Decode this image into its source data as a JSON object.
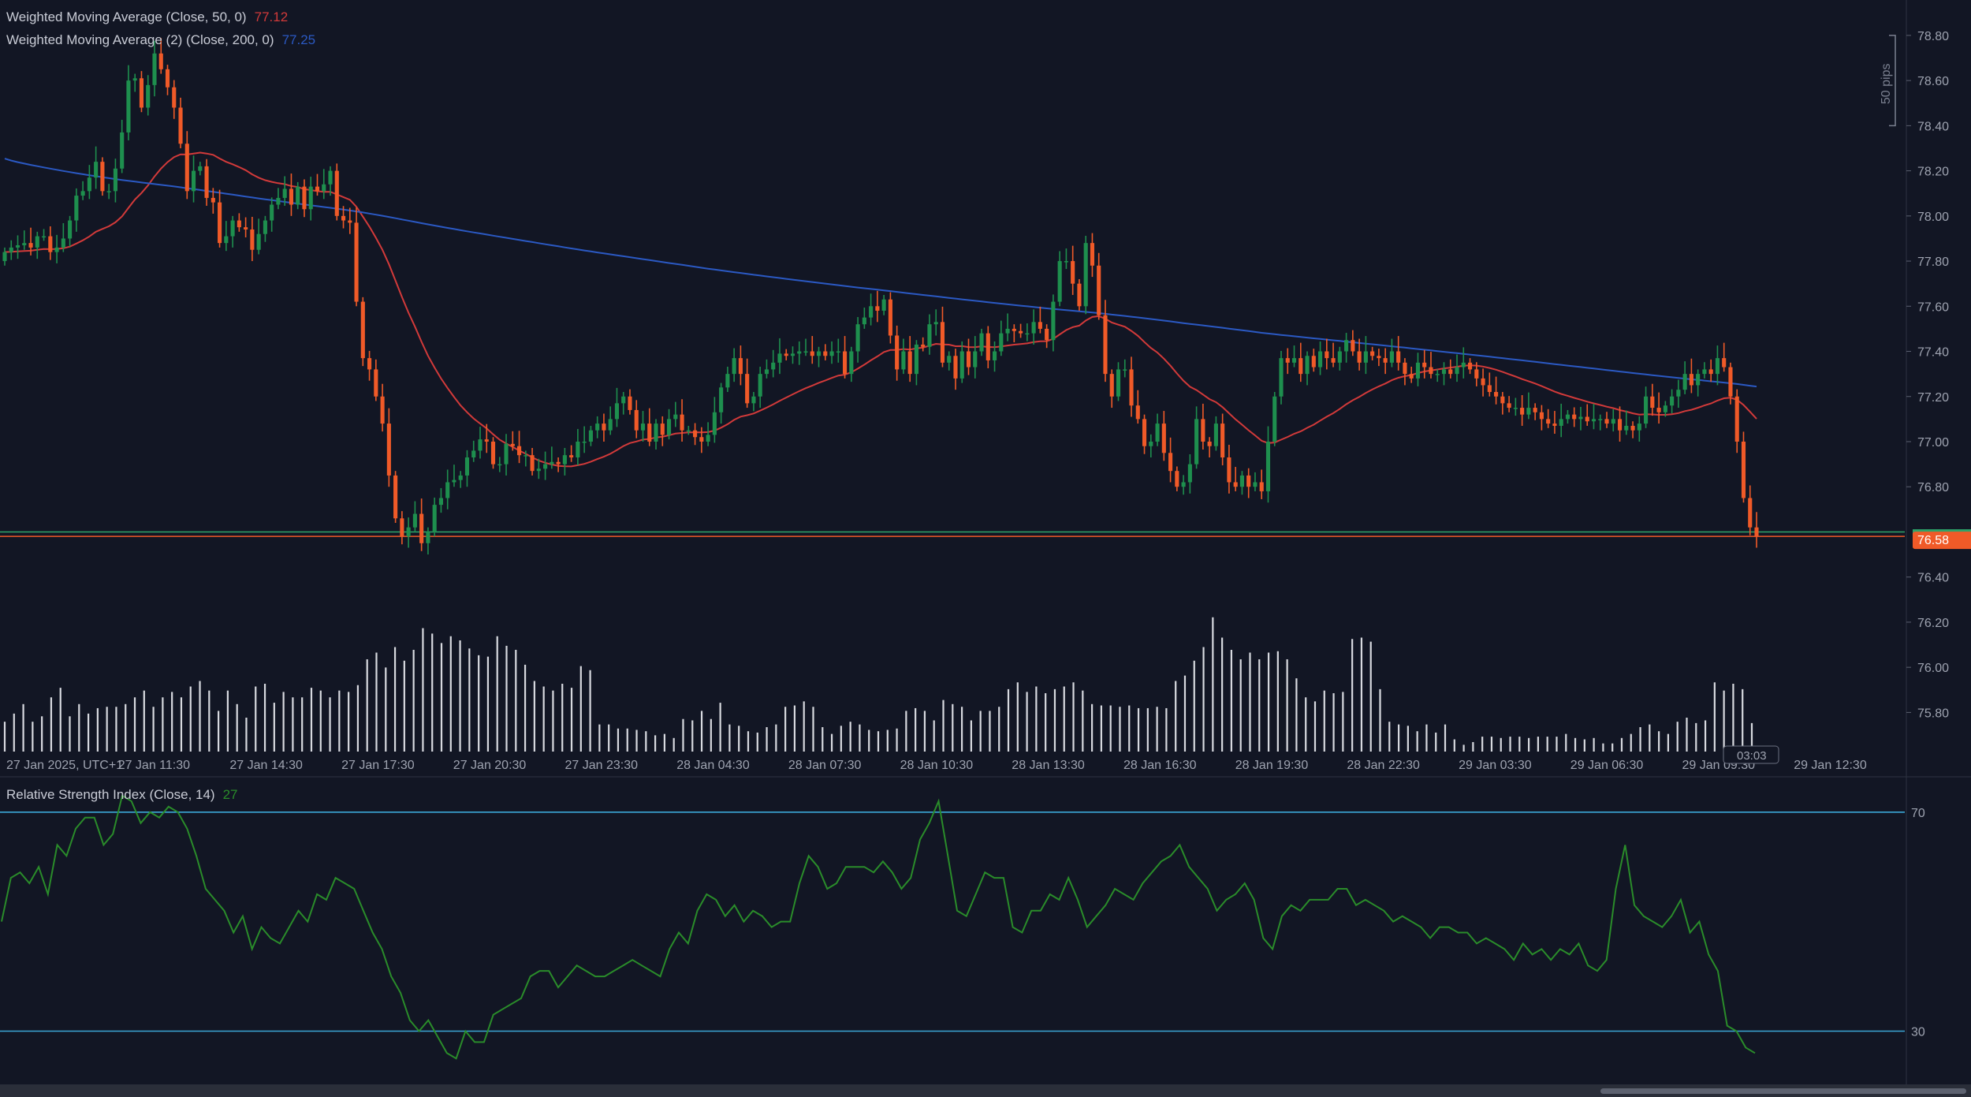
{
  "colors": {
    "background": "#121624",
    "up": "#1e8f4e",
    "down": "#f05a28",
    "wma50": "#d23a3a",
    "wma200": "#2b59c3",
    "rsi": "#2a8c2a",
    "rsi_band": "#3ba7d6",
    "bid_line": "#2ea36a",
    "ask_line": "#f05a28",
    "grid_text": "#9ea3b0",
    "volume": "#d8dae0"
  },
  "legend": {
    "wma50_label": "Weighted Moving Average (Close, 50, 0)",
    "wma50_value": "77.12",
    "wma200_label": "Weighted Moving Average (2) (Close, 200, 0)",
    "wma200_value": "77.25",
    "rsi_label": "Relative Strength Index (Close, 14)",
    "rsi_value": "27"
  },
  "price_axis": {
    "ticks": [
      "78.80",
      "78.60",
      "78.40",
      "78.20",
      "78.00",
      "77.80",
      "77.60",
      "77.40",
      "77.20",
      "77.00",
      "76.80",
      "76.40",
      "76.20",
      "76.00",
      "75.80"
    ],
    "current_price": "76.58",
    "range_label": "50 pips"
  },
  "rsi_axis": {
    "ticks": [
      "70",
      "30"
    ]
  },
  "time_axis": {
    "labels": [
      "27 Jan 2025, UTC+1",
      "27 Jan 11:30",
      "27 Jan 14:30",
      "27 Jan 17:30",
      "27 Jan 20:30",
      "27 Jan 23:30",
      "28 Jan 04:30",
      "28 Jan 07:30",
      "28 Jan 10:30",
      "28 Jan 13:30",
      "28 Jan 16:30",
      "28 Jan 19:30",
      "28 Jan 22:30",
      "29 Jan 03:30",
      "29 Jan 06:30",
      "29 Jan 09:30",
      "29 Jan 12:30"
    ],
    "countdown": "03:03"
  },
  "chart_data": {
    "type": "candlestick",
    "price_scale": [
      75.7,
      78.88
    ],
    "horizontal_lines": [
      {
        "name": "bid",
        "value": 76.6
      },
      {
        "name": "ask",
        "value": 76.58
      }
    ],
    "closes": [
      77.84,
      77.86,
      77.87,
      77.88,
      77.86,
      77.91,
      77.91,
      77.84,
      77.86,
      77.9,
      77.98,
      78.09,
      78.11,
      78.17,
      78.24,
      78.11,
      78.11,
      78.21,
      78.37,
      78.6,
      78.61,
      78.48,
      78.58,
      78.72,
      78.65,
      78.57,
      78.48,
      78.32,
      78.11,
      78.2,
      78.22,
      78.08,
      78.06,
      77.88,
      77.91,
      77.98,
      77.95,
      77.94,
      77.85,
      77.92,
      77.98,
      78.05,
      78.08,
      78.12,
      78.05,
      78.13,
      78.03,
      78.13,
      78.11,
      78.14,
      78.2,
      78.0,
      77.98,
      77.97,
      77.62,
      77.37,
      77.32,
      77.2,
      77.08,
      76.85,
      76.66,
      76.58,
      76.62,
      76.68,
      76.55,
      76.6,
      76.72,
      76.75,
      76.82,
      76.83,
      76.85,
      76.93,
      76.96,
      77.01,
      77.0,
      76.9,
      76.9,
      76.99,
      76.98,
      76.94,
      76.94,
      76.87,
      76.88,
      76.9,
      76.91,
      76.9,
      76.94,
      76.93,
      77.0,
      77.0,
      77.05,
      77.08,
      77.05,
      77.1,
      77.17,
      77.2,
      77.14,
      77.05,
      77.08,
      77.0,
      77.08,
      77.03,
      77.1,
      77.12,
      77.05,
      77.05,
      77.02,
      77.0,
      77.03,
      77.13,
      77.24,
      77.3,
      77.37,
      77.3,
      77.17,
      77.2,
      77.3,
      77.32,
      77.35,
      77.39,
      77.38,
      77.39,
      77.4,
      77.4,
      77.38,
      77.4,
      77.38,
      77.4,
      77.4,
      77.3,
      77.4,
      77.52,
      77.55,
      77.6,
      77.58,
      77.63,
      77.47,
      77.32,
      77.4,
      77.3,
      77.43,
      77.42,
      77.52,
      77.53,
      77.35,
      77.38,
      77.28,
      77.4,
      77.33,
      77.4,
      77.48,
      77.36,
      77.4,
      77.48,
      77.5,
      77.49,
      77.48,
      77.48,
      77.53,
      77.5,
      77.45,
      77.62,
      77.8,
      77.8,
      77.7,
      77.6,
      77.88,
      77.78,
      77.56,
      77.3,
      77.2,
      77.32,
      77.32,
      77.16,
      77.1,
      76.98,
      77.0,
      77.08,
      76.95,
      76.87,
      76.8,
      76.82,
      76.9,
      77.1,
      77.0,
      76.98,
      77.08,
      76.93,
      76.82,
      76.8,
      76.85,
      76.8,
      76.82,
      76.78,
      77.0,
      77.2,
      77.37,
      77.35,
      77.37,
      77.3,
      77.38,
      77.33,
      77.4,
      77.37,
      77.35,
      77.4,
      77.45,
      77.4,
      77.35,
      77.4,
      77.38,
      77.37,
      77.35,
      77.4,
      77.35,
      77.3,
      77.28,
      77.35,
      77.33,
      77.3,
      77.3,
      77.32,
      77.3,
      77.33,
      77.35,
      77.32,
      77.28,
      77.25,
      77.22,
      77.2,
      77.17,
      77.15,
      77.15,
      77.12,
      77.15,
      77.13,
      77.1,
      77.08,
      77.07,
      77.1,
      77.12,
      77.1,
      77.11,
      77.09,
      77.1,
      77.1,
      77.08,
      77.1,
      77.05,
      77.07,
      77.05,
      77.08,
      77.2,
      77.15,
      77.13,
      77.16,
      77.2,
      77.23,
      77.3,
      77.25,
      77.3,
      77.32,
      77.3,
      77.37,
      77.33,
      77.2,
      77.0,
      76.75,
      76.62,
      76.58
    ],
    "wma50_start": 77.82,
    "wma50_end": 77.12,
    "wma200_start": 78.29,
    "wma200_end": 77.25,
    "rsi_scale": [
      21,
      74
    ],
    "rsi_bands": [
      70,
      30
    ],
    "rsi": [
      50,
      58,
      59,
      57,
      60,
      55,
      64,
      62,
      67,
      69,
      69,
      64,
      66,
      73,
      72,
      68,
      70,
      69,
      71,
      70,
      67,
      62,
      56,
      54,
      52,
      48,
      51,
      45,
      49,
      47,
      46,
      49,
      52,
      50,
      55,
      54,
      58,
      57,
      56,
      52,
      48,
      45,
      40,
      37,
      32,
      30,
      32,
      29,
      26,
      25,
      30,
      28,
      28,
      33,
      34,
      35,
      36,
      40,
      41,
      41,
      38,
      40,
      42,
      41,
      40,
      40,
      41,
      42,
      43,
      42,
      41,
      40,
      45,
      48,
      46,
      52,
      55,
      54,
      51,
      53,
      50,
      52,
      51,
      49,
      50,
      50,
      57,
      62,
      60,
      56,
      57,
      60,
      60,
      60,
      59,
      61,
      59,
      56,
      58,
      65,
      68,
      72,
      62,
      52,
      51,
      55,
      59,
      58,
      58,
      49,
      48,
      52,
      52,
      55,
      54,
      58,
      54,
      49,
      51,
      53,
      56,
      55,
      54,
      57,
      59,
      61,
      62,
      64,
      60,
      58,
      56,
      52,
      54,
      55,
      57,
      54,
      47,
      45,
      51,
      53,
      52,
      54,
      54,
      54,
      56,
      56,
      53,
      54,
      53,
      52,
      50,
      51,
      50,
      49,
      47,
      49,
      49,
      48,
      48,
      46,
      47,
      46,
      45,
      43,
      46,
      44,
      45,
      43,
      45,
      44,
      46,
      42,
      41,
      43,
      56,
      64,
      53,
      51,
      50,
      49,
      51,
      54,
      48,
      50,
      44,
      41,
      31,
      30,
      27,
      26
    ],
    "volume_scale": [
      0,
      1
    ],
    "volume": [
      0.22,
      0.28,
      0.35,
      0.22,
      0.26,
      0.4,
      0.47,
      0.26,
      0.35,
      0.28,
      0.32,
      0.33,
      0.33,
      0.35,
      0.4,
      0.45,
      0.33,
      0.4,
      0.44,
      0.4,
      0.48,
      0.52,
      0.45,
      0.3,
      0.45,
      0.35,
      0.25,
      0.48,
      0.5,
      0.36,
      0.44,
      0.4,
      0.4,
      0.47,
      0.45,
      0.4,
      0.45,
      0.44,
      0.49,
      0.68,
      0.73,
      0.62,
      0.77,
      0.67,
      0.75,
      0.91,
      0.87,
      0.8,
      0.85,
      0.82,
      0.76,
      0.71,
      0.7,
      0.85,
      0.78,
      0.75,
      0.64,
      0.52,
      0.48,
      0.45,
      0.5,
      0.47,
      0.63,
      0.6,
      0.2,
      0.2,
      0.17,
      0.17,
      0.16,
      0.15,
      0.12,
      0.13,
      0.1,
      0.24,
      0.23,
      0.3,
      0.24,
      0.36,
      0.2,
      0.19,
      0.15,
      0.14,
      0.18,
      0.2,
      0.33,
      0.34,
      0.37,
      0.33,
      0.18,
      0.13,
      0.19,
      0.22,
      0.2,
      0.16,
      0.15,
      0.16,
      0.17,
      0.3,
      0.32,
      0.3,
      0.23,
      0.38,
      0.35,
      0.33,
      0.23,
      0.3,
      0.3,
      0.33,
      0.46,
      0.51,
      0.44,
      0.48,
      0.43,
      0.46,
      0.48,
      0.51,
      0.45,
      0.35,
      0.34,
      0.34,
      0.33,
      0.34,
      0.32,
      0.32,
      0.33,
      0.32,
      0.52,
      0.56,
      0.67,
      0.77,
      0.99,
      0.84,
      0.75,
      0.68,
      0.73,
      0.68,
      0.73,
      0.74,
      0.68,
      0.54,
      0.4,
      0.37,
      0.45,
      0.43,
      0.44,
      0.83,
      0.84,
      0.81,
      0.46,
      0.22,
      0.2,
      0.19,
      0.15,
      0.2,
      0.14,
      0.2,
      0.09,
      0.05,
      0.07,
      0.11,
      0.11,
      0.1,
      0.11,
      0.11,
      0.1,
      0.11,
      0.11,
      0.11,
      0.13,
      0.1,
      0.09,
      0.1,
      0.06,
      0.06,
      0.1,
      0.13,
      0.18,
      0.2,
      0.15,
      0.13,
      0.22,
      0.25,
      0.21,
      0.23,
      0.51,
      0.45,
      0.5,
      0.46,
      0.21
    ],
    "x_time_labels": [
      "27 Jan 2025, UTC+1",
      "27 Jan 11:30",
      "27 Jan 14:30",
      "27 Jan 17:30",
      "27 Jan 20:30",
      "27 Jan 23:30",
      "28 Jan 04:30",
      "28 Jan 07:30",
      "28 Jan 10:30",
      "28 Jan 13:30",
      "28 Jan 16:30",
      "28 Jan 19:30",
      "28 Jan 22:30",
      "29 Jan 03:30",
      "29 Jan 06:30",
      "29 Jan 09:30",
      "29 Jan 12:30"
    ]
  }
}
